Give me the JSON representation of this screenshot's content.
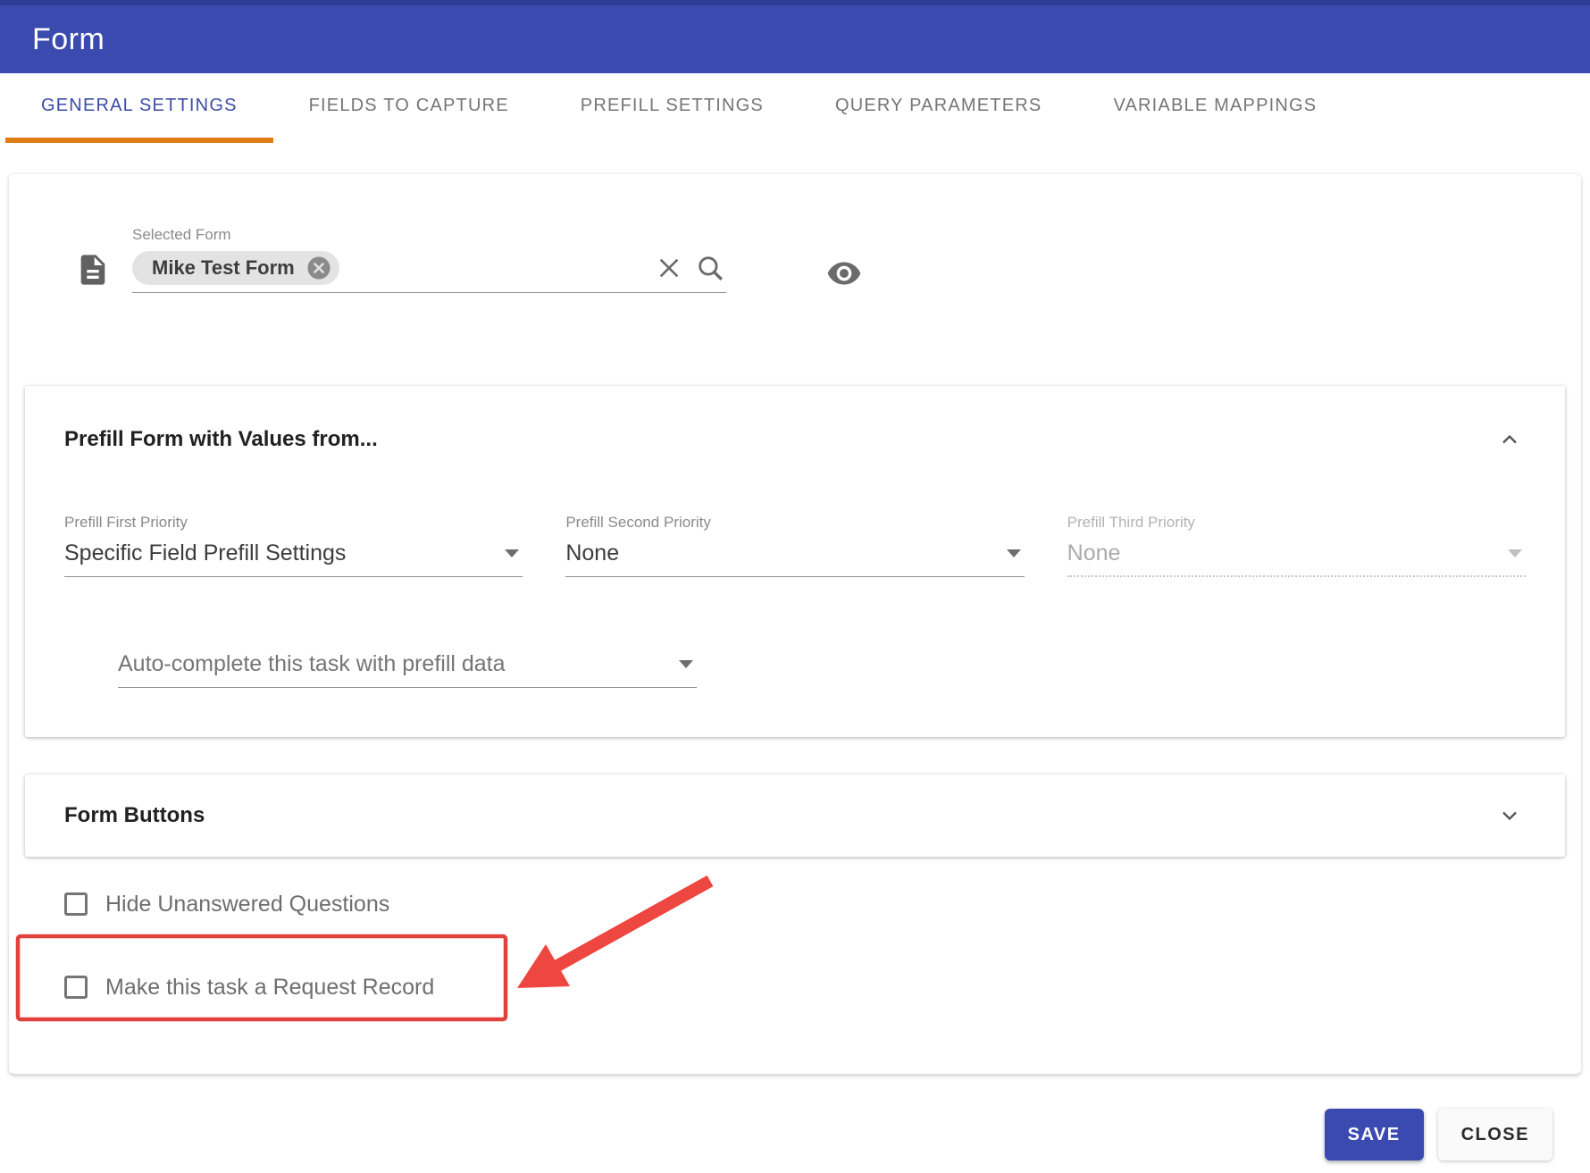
{
  "colors": {
    "header_bg": "#3a4aae",
    "header_edge": "#2e3b94",
    "active_tab_blue": "#3b4ca8",
    "tab_underline_orange": "#e07d15",
    "annotation_red": "#e0413c",
    "save_button_bg": "#3a4ab1"
  },
  "header": {
    "title": "Form"
  },
  "tabs": [
    {
      "label": "GENERAL SETTINGS",
      "active": true
    },
    {
      "label": "FIELDS TO CAPTURE",
      "active": false
    },
    {
      "label": "PREFILL SETTINGS",
      "active": false
    },
    {
      "label": "QUERY PARAMETERS",
      "active": false
    },
    {
      "label": "VARIABLE MAPPINGS",
      "active": false
    }
  ],
  "selected_form": {
    "label": "Selected Form",
    "chip_text": "Mike Test Form",
    "icons": {
      "left": "document-icon",
      "chip": "chip-remove-icon",
      "clear": "clear-icon",
      "search": "search-icon",
      "preview": "eye-icon"
    }
  },
  "prefill_panel": {
    "title": "Prefill Form with Values from...",
    "dropdowns": [
      {
        "label": "Prefill First Priority",
        "value": "Specific Field Prefill Settings",
        "disabled": false
      },
      {
        "label": "Prefill Second Priority",
        "value": "None",
        "disabled": false
      },
      {
        "label": "Prefill Third Priority",
        "value": "None",
        "disabled": true
      }
    ],
    "autocomplete_value": "Auto-complete this task with prefill data"
  },
  "form_buttons_panel": {
    "title": "Form Buttons"
  },
  "checkboxes": [
    {
      "label": "Hide Unanswered Questions",
      "checked": false,
      "highlighted": false
    },
    {
      "label": "Make this task a Request Record",
      "checked": false,
      "highlighted": true
    }
  ],
  "footer": {
    "save_label": "SAVE",
    "close_label": "CLOSE"
  }
}
